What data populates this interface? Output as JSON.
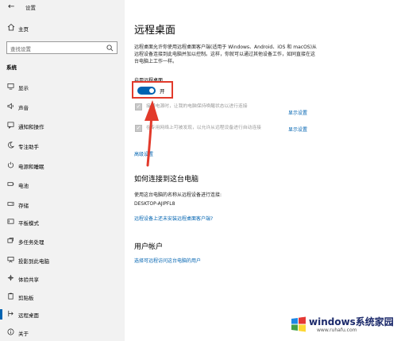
{
  "window": {
    "title": "设置"
  },
  "sidebar": {
    "home_label": "主页",
    "search_placeholder": "查找设置",
    "section": "系统",
    "items": [
      {
        "label": "显示",
        "icon": "monitor-icon"
      },
      {
        "label": "声音",
        "icon": "speaker-icon"
      },
      {
        "label": "通知和操作",
        "icon": "notification-icon"
      },
      {
        "label": "专注助手",
        "icon": "moon-icon"
      },
      {
        "label": "电源和睡眠",
        "icon": "power-icon"
      },
      {
        "label": "电池",
        "icon": "battery-icon"
      },
      {
        "label": "存储",
        "icon": "storage-icon"
      },
      {
        "label": "平板模式",
        "icon": "tablet-icon"
      },
      {
        "label": "多任务处理",
        "icon": "multitask-icon"
      },
      {
        "label": "投影到此电脑",
        "icon": "project-icon"
      },
      {
        "label": "体验共享",
        "icon": "share-icon"
      },
      {
        "label": "剪贴板",
        "icon": "clipboard-icon"
      },
      {
        "label": "远程桌面",
        "icon": "remote-icon",
        "active": true
      },
      {
        "label": "关于",
        "icon": "info-icon"
      }
    ]
  },
  "main": {
    "title": "远程桌面",
    "description": "远程桌面允许你使用远程桌面客户端(适用于 Windows、Android、iOS 和 macOS)从远程设备连接到此电脑并加以控制。这样，你就可以通过其他设备工作，如同直接在这台电脑上工作一样。",
    "toggle_label": "启用远程桌面",
    "toggle_state": "开",
    "toggle_on": true,
    "option1_text": "接通电源时，让我的电脑保持唤醒状态以进行连接",
    "option1_link": "显示设置",
    "option2_text": "在专用网络上可被发现，以允许从远程设备进行自动连接",
    "option2_link": "显示设置",
    "advanced_link": "高级设置",
    "connect_heading": "如何连接到这台电脑",
    "connect_desc": "使用这台电脑的名称从远程设备进行连接:",
    "pc_name": "DESKTOP-AJIPFL8",
    "no_client_link": "远程设备上还未安装远程桌面客户端?",
    "accounts_heading": "用户帐户",
    "accounts_link": "选择可远程访问这台电脑的用户"
  },
  "watermark": {
    "main": "windows系统家园",
    "sub": "www.ruhafu.com"
  },
  "colors": {
    "accent": "#0063b1",
    "highlight": "#e23a2b",
    "sidebar_bg": "#f2f2f2"
  }
}
